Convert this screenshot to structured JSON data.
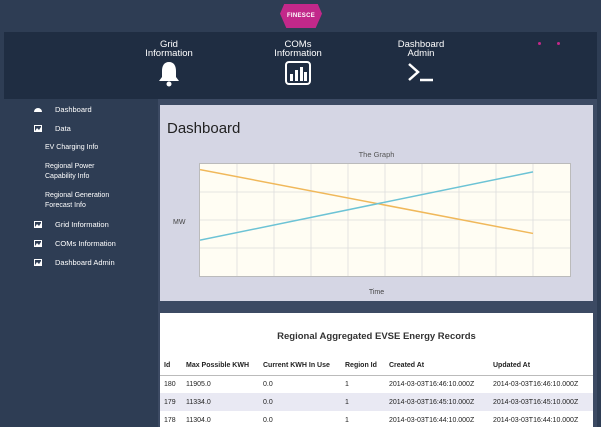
{
  "brand": {
    "logo_text": "FINESCE"
  },
  "topnav": {
    "items": [
      {
        "line1": "Grid",
        "line2": "Information",
        "icon": "bell-icon"
      },
      {
        "line1": "COMs",
        "line2": "Information",
        "icon": "bar-chart-icon"
      },
      {
        "line1": "Dashboard",
        "line2": "Admin",
        "icon": "terminal-icon"
      }
    ]
  },
  "sidebar": {
    "items": [
      {
        "label": "Dashboard",
        "icon": "dashboard-icon"
      },
      {
        "label": "Data",
        "icon": "picture-icon"
      },
      {
        "label": "EV Charging Info"
      },
      {
        "label": "Regional Power Capability Info"
      },
      {
        "label": "Regional Generation Forecast Info"
      },
      {
        "label": "Grid Information",
        "icon": "picture-icon"
      },
      {
        "label": "COMs Information",
        "icon": "picture-icon"
      },
      {
        "label": "Dashboard Admin",
        "icon": "picture-icon"
      }
    ]
  },
  "main": {
    "title": "Dashboard"
  },
  "chart_data": {
    "type": "line",
    "title": "The Graph",
    "xlabel": "Time",
    "ylabel": "MW",
    "grid": true,
    "series": [
      {
        "color": "#f0b85a",
        "points": [
          [
            0,
            0.95
          ],
          [
            1,
            0.38
          ]
        ]
      },
      {
        "color": "#6cc3d5",
        "points": [
          [
            0,
            0.32
          ],
          [
            1,
            0.93
          ]
        ]
      }
    ]
  },
  "records": {
    "title": "Regional Aggregated EVSE Energy Records",
    "columns": [
      "Id",
      "Max Possible KWH",
      "Current KWH In Use",
      "Region Id",
      "Created At",
      "Updated At"
    ],
    "rows": [
      [
        "180",
        "11905.0",
        "0.0",
        "1",
        "2014-03-03T16:46:10.000Z",
        "2014-03-03T16:46:10.000Z"
      ],
      [
        "179",
        "11334.0",
        "0.0",
        "1",
        "2014-03-03T16:45:10.000Z",
        "2014-03-03T16:45:10.000Z"
      ],
      [
        "178",
        "11304.0",
        "0.0",
        "1",
        "2014-03-03T16:44:10.000Z",
        "2014-03-03T16:44:10.000Z"
      ]
    ]
  },
  "colors": {
    "accent": "#c2288a",
    "nav_bg": "#1f2d42",
    "sidebar_bg": "#2e3d54"
  }
}
